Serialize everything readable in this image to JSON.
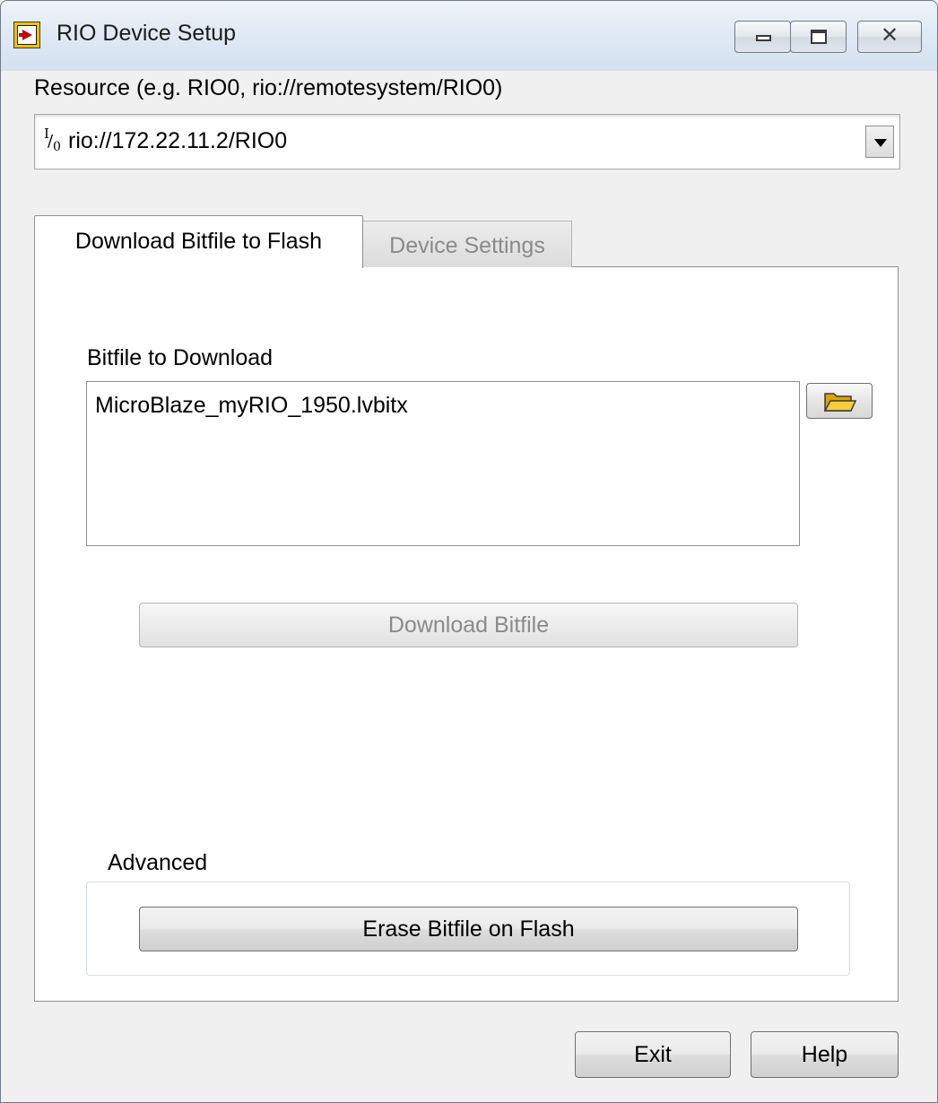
{
  "window": {
    "title": "RIO Device Setup",
    "app_icon": "labview-vi-icon",
    "caption_buttons": [
      "minimize",
      "maximize",
      "close"
    ]
  },
  "resource": {
    "label": "Resource (e.g. RIO0, rio://remotesystem/RIO0)",
    "value": "rio://172.22.11.2/RIO0",
    "icon": "io-resource-icon"
  },
  "tabs": [
    {
      "label": "Download Bitfile to Flash",
      "active": true
    },
    {
      "label": "Device Settings",
      "active": false
    }
  ],
  "download_tab": {
    "bitfile_label": "Bitfile to Download",
    "bitfile_value": "MicroBlaze_myRIO_1950.lvbitx",
    "browse_icon": "folder-icon",
    "download_button": "Download Bitfile",
    "download_enabled": false,
    "advanced_label": "Advanced",
    "erase_button": "Erase Bitfile on Flash"
  },
  "footer": {
    "exit_button": "Exit",
    "help_button": "Help"
  },
  "colors": {
    "titlebar": "#dfe9f4",
    "window_bg": "#f0f0f0",
    "panel_bg": "#ffffff",
    "disabled_text": "#8a8a8a"
  }
}
